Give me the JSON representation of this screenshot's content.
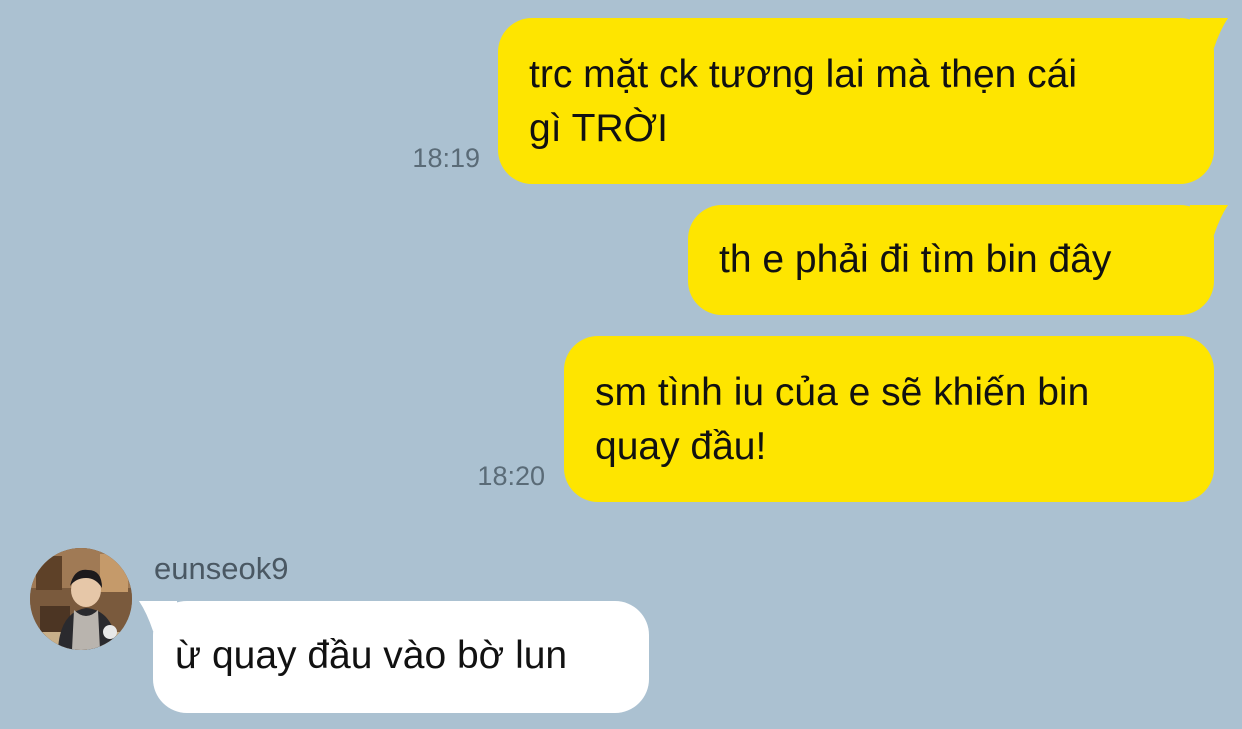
{
  "chat": {
    "messages": [
      {
        "direction": "outgoing",
        "text": "trc mặt ck tương lai mà thẹn cái\ngì TRỜI",
        "time": "18:19"
      },
      {
        "direction": "outgoing",
        "text": "th e phải đi tìm bin đây",
        "time": ""
      },
      {
        "direction": "outgoing",
        "text": "sm tình iu của e sẽ khiến bin\nquay đầu!",
        "time": "18:20"
      },
      {
        "direction": "incoming",
        "sender": "eunseok9",
        "text": "ừ quay đầu vào bờ lun",
        "time": ""
      }
    ]
  },
  "colors": {
    "background": "#abc1d1",
    "outgoing_bubble": "#fee500",
    "incoming_bubble": "#ffffff",
    "timestamp": "#5a6b77"
  },
  "icons": {
    "avatar": "profile-photo"
  }
}
